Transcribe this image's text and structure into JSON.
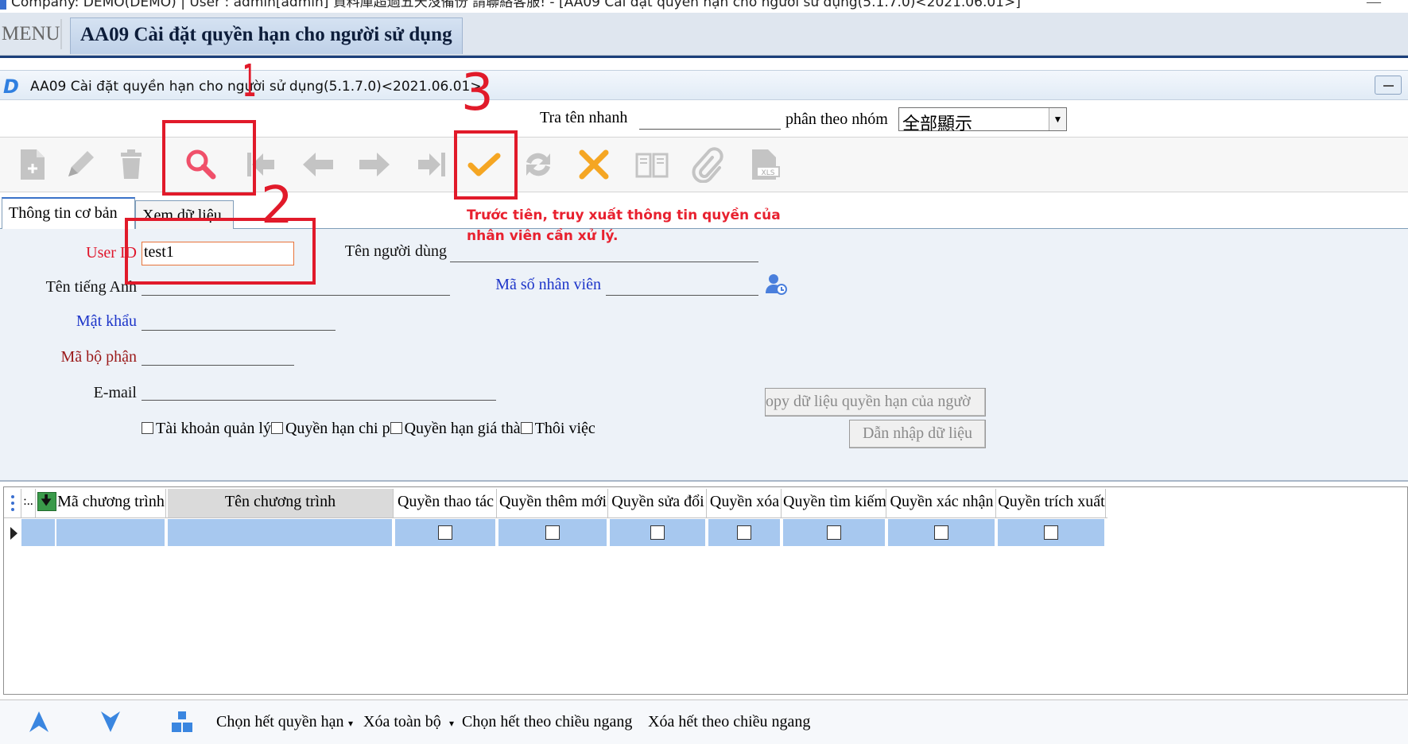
{
  "window": {
    "title": "Company: DEMO(DEMO) | User : admin[admin] 資料庫超過五天沒備份 請聯絡客服! - [AA09 Cài đặt quyền hạn cho người sử dụng(5.1.7.0)<2021.06.01>]",
    "minimize_glyph": "—"
  },
  "menubar": {
    "menu_label": "MENU",
    "active_module": "AA09 Cài đặt quyền hạn cho người sử dụng"
  },
  "form_header": {
    "logo": "D",
    "title": "AA09 Cài đặt quyền hạn cho người sử dụng(5.1.7.0)<2021.06.01>"
  },
  "search": {
    "quick_search_label": "Tra tên nhanh",
    "quick_search_value": "",
    "group_label": "phân theo nhóm",
    "group_value": "全部顯示",
    "dropdown_arrow": "▼"
  },
  "toolbar": {
    "buttons": [
      "new-icon",
      "edit-icon",
      "delete-icon",
      "search-icon",
      "first-icon",
      "prev-icon",
      "next-icon",
      "last-icon",
      "confirm-icon",
      "refresh-icon",
      "cancel-icon",
      "book-icon",
      "attach-icon",
      "xls-icon"
    ],
    "xls_text": "XLS"
  },
  "tabs": [
    {
      "label": "Thông tin cơ bản"
    },
    {
      "label": "Xem dữ liệu"
    }
  ],
  "form": {
    "user_id_label": "User ID",
    "user_id_value": "test1",
    "user_name_label": "Tên người dùng",
    "user_name_value": "",
    "english_name_label": "Tên tiếng Anh",
    "english_name_value": "",
    "employee_no_label": "Mã số nhân viên",
    "employee_no_value": "",
    "password_label": "Mật khẩu",
    "password_value": "",
    "department_label": "Mã bộ phận",
    "department_value": "",
    "email_label": "E-mail",
    "email_value": "",
    "checkboxes": [
      {
        "label": "Tài khoản quản lý",
        "checked": false
      },
      {
        "label": "Quyền hạn chi p",
        "checked": false
      },
      {
        "label": "Quyền hạn giá thà",
        "checked": false
      },
      {
        "label": "Thôi việc",
        "checked": false
      }
    ],
    "copy_button": "opy dữ liệu quyền hạn của ngườ",
    "import_button": "Dẫn nhập dữ liệu"
  },
  "grid": {
    "corner_label": ":..",
    "columns": [
      "Mã chương trình",
      "Tên chương trình",
      "Quyền thao tác",
      "Quyền thêm mới",
      "Quyền sửa đổi",
      "Quyền xóa",
      "Quyền tìm kiếm",
      "Quyền xác nhận",
      "Quyền trích xuất"
    ],
    "rows": [
      {
        "program_code": "",
        "program_name": "",
        "operate": false,
        "add": false,
        "edit": false,
        "delete": false,
        "search": false,
        "confirm": false,
        "export": false
      }
    ]
  },
  "bottom_bar": {
    "icons": [
      "arrow-up-icon",
      "arrow-down-icon",
      "blocks-icon"
    ],
    "actions": [
      "Chọn hết quyền hạn",
      "Xóa toàn bộ",
      "Chọn hết theo chiều ngang",
      "Xóa hết theo chiều ngang"
    ]
  },
  "annotations": {
    "step_numbers": [
      "1",
      "2",
      "3"
    ],
    "note": "Trước tiên, truy xuất thông tin quyền của nhân viên cần xử lý.",
    "color": "#e11a2a"
  }
}
